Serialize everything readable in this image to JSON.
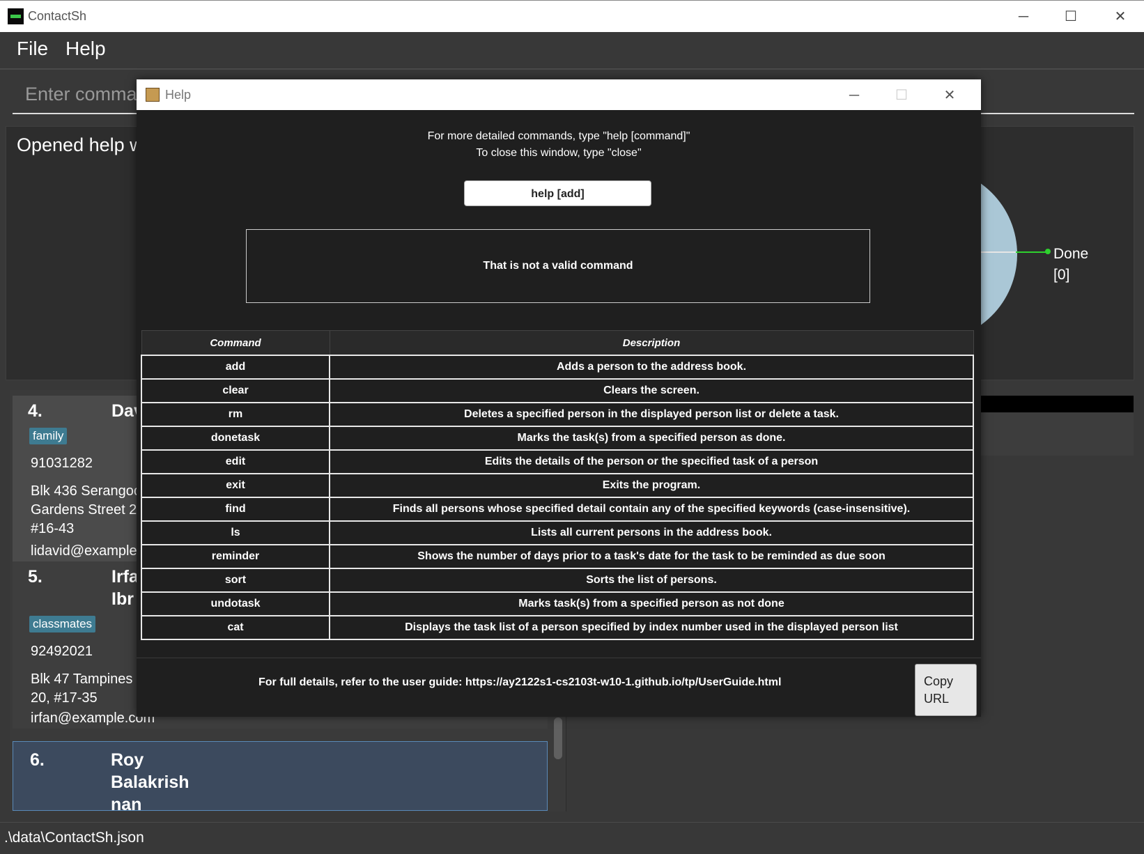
{
  "window": {
    "title": "ContactSh",
    "minimize": "─",
    "maximize": "☐",
    "close": "✕"
  },
  "menu": {
    "file": "File",
    "help": "Help"
  },
  "command_box": {
    "placeholder": "Enter comma"
  },
  "result_display": {
    "text": "Opened help w"
  },
  "chart": {
    "label_done": "Done",
    "label_count": "[0]",
    "colors": {
      "slice": "#aac7d6",
      "pointer": "#2ed12e"
    }
  },
  "persons": [
    {
      "index": "4.",
      "name": "Dav",
      "tag": "family",
      "phone": "91031282",
      "address_lines": [
        "Blk 436 Serangoo",
        "Gardens Street 2",
        "#16-43"
      ],
      "email": "lidavid@example"
    },
    {
      "index": "5.",
      "name_lines": [
        "Irfa",
        "Ibr"
      ],
      "tag": "classmates",
      "phone": "92492021",
      "address_lines": [
        "Blk 47 Tampines",
        "20, #17-35"
      ],
      "email": "irfan@example.com"
    },
    {
      "index": "6.",
      "name_lines": [
        "Roy",
        "Balakrish",
        "nan"
      ]
    }
  ],
  "status_bar": {
    "path": ".\\data\\ContactSh.json"
  },
  "help_dialog": {
    "title": "Help",
    "minimize": "─",
    "maximize": "☐",
    "close": "✕",
    "info_line1": "For more detailed commands, type \"help [command]\"",
    "info_line2": "To close this window, type \"close\"",
    "help_button_label": "help [add]",
    "message": "That is not a valid command",
    "table_headers": {
      "command": "Command",
      "description": "Description"
    },
    "commands": [
      {
        "command": "add",
        "description": "Adds a person to the address book."
      },
      {
        "command": "clear",
        "description": "Clears the screen."
      },
      {
        "command": "rm",
        "description": "Deletes a specified person in the displayed person list or delete a task."
      },
      {
        "command": "donetask",
        "description": "Marks the task(s) from a specified person as done."
      },
      {
        "command": "edit",
        "description": "Edits the details of the person or the specified task of a person"
      },
      {
        "command": "exit",
        "description": "Exits the program."
      },
      {
        "command": "find",
        "description": "Finds all persons whose specified detail contain any of the specified keywords (case-insensitive)."
      },
      {
        "command": "ls",
        "description": "Lists all current persons in the address book."
      },
      {
        "command": "reminder",
        "description": "Shows the number of days prior to a task's date for the task to be reminded as due soon"
      },
      {
        "command": "sort",
        "description": "Sorts the list of persons."
      },
      {
        "command": "undotask",
        "description": "Marks task(s) from a specified person as not done"
      },
      {
        "command": "cat",
        "description": "Displays the task list of a person specified by index number used in the displayed person list"
      }
    ],
    "footer_text": "For full details, refer to the user guide: https://ay2122s1-cs2103t-w10-1.github.io/tp/UserGuide.html",
    "copy_button_line1": "Copy",
    "copy_button_line2": "URL"
  }
}
